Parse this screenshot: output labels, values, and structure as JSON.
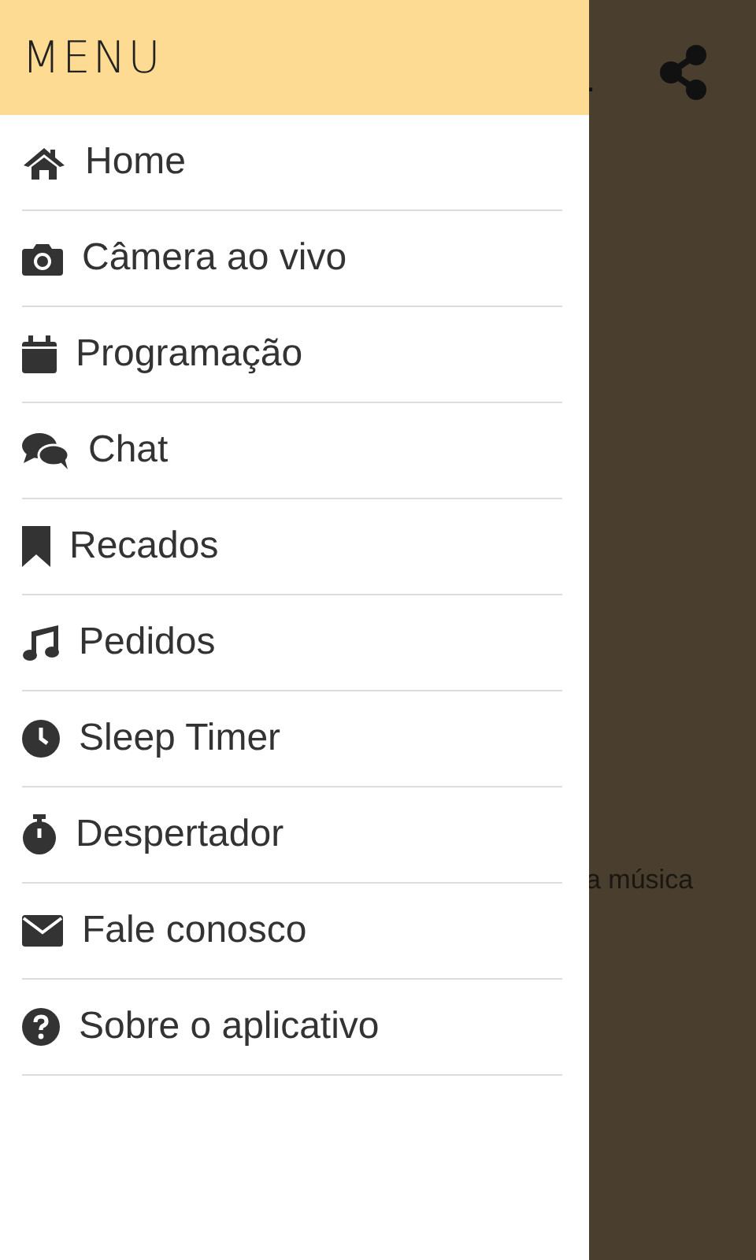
{
  "background": {
    "title_fragment": ".",
    "text_fragment": "a música"
  },
  "drawer": {
    "title": "MENU",
    "items": [
      {
        "label": "Home"
      },
      {
        "label": "Câmera ao vivo"
      },
      {
        "label": "Programação"
      },
      {
        "label": "Chat"
      },
      {
        "label": "Recados"
      },
      {
        "label": "Pedidos"
      },
      {
        "label": "Sleep Timer"
      },
      {
        "label": "Despertador"
      },
      {
        "label": "Fale conosco"
      },
      {
        "label": "Sobre o aplicativo"
      }
    ]
  }
}
